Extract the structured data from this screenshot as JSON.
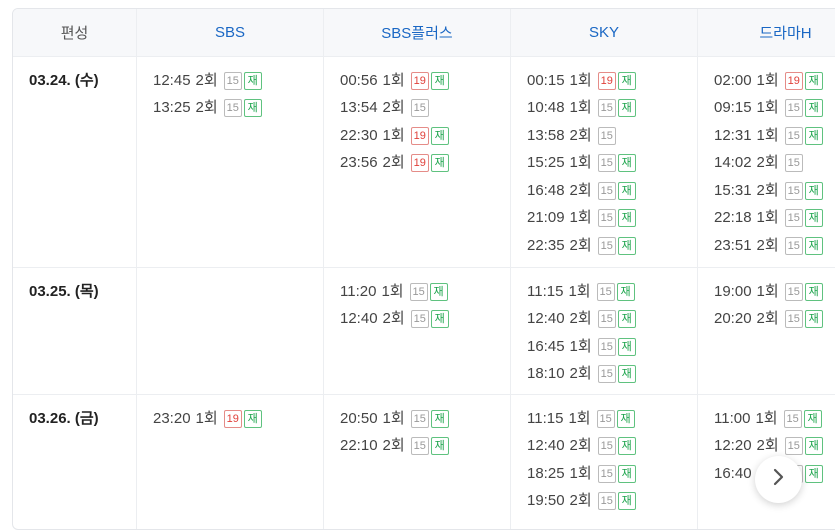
{
  "header": {
    "col0": "편성",
    "channels": [
      "SBS",
      "SBS플러스",
      "SKY",
      "드라마H"
    ]
  },
  "badges": {
    "age15": "15",
    "age19": "19",
    "rerun": "재"
  },
  "rows": [
    {
      "date": "03.24. (수)",
      "channels": [
        [
          {
            "time": "12:45",
            "ep": "2회",
            "age": "15",
            "rerun": true
          },
          {
            "time": "13:25",
            "ep": "2회",
            "age": "15",
            "rerun": true
          }
        ],
        [
          {
            "time": "00:56",
            "ep": "1회",
            "age": "19",
            "rerun": true
          },
          {
            "time": "13:54",
            "ep": "2회",
            "age": "15",
            "rerun": false
          },
          {
            "time": "22:30",
            "ep": "1회",
            "age": "19",
            "rerun": true
          },
          {
            "time": "23:56",
            "ep": "2회",
            "age": "19",
            "rerun": true
          }
        ],
        [
          {
            "time": "00:15",
            "ep": "1회",
            "age": "19",
            "rerun": true
          },
          {
            "time": "10:48",
            "ep": "1회",
            "age": "15",
            "rerun": true
          },
          {
            "time": "13:58",
            "ep": "2회",
            "age": "15",
            "rerun": false
          },
          {
            "time": "15:25",
            "ep": "1회",
            "age": "15",
            "rerun": true
          },
          {
            "time": "16:48",
            "ep": "2회",
            "age": "15",
            "rerun": true
          },
          {
            "time": "21:09",
            "ep": "1회",
            "age": "15",
            "rerun": true
          },
          {
            "time": "22:35",
            "ep": "2회",
            "age": "15",
            "rerun": true
          }
        ],
        [
          {
            "time": "02:00",
            "ep": "1회",
            "age": "19",
            "rerun": true
          },
          {
            "time": "09:15",
            "ep": "1회",
            "age": "15",
            "rerun": true
          },
          {
            "time": "12:31",
            "ep": "1회",
            "age": "15",
            "rerun": true
          },
          {
            "time": "14:02",
            "ep": "2회",
            "age": "15",
            "rerun": false
          },
          {
            "time": "15:31",
            "ep": "2회",
            "age": "15",
            "rerun": true
          },
          {
            "time": "22:18",
            "ep": "1회",
            "age": "15",
            "rerun": true
          },
          {
            "time": "23:51",
            "ep": "2회",
            "age": "15",
            "rerun": true
          }
        ]
      ]
    },
    {
      "date": "03.25. (목)",
      "channels": [
        [],
        [
          {
            "time": "11:20",
            "ep": "1회",
            "age": "15",
            "rerun": true
          },
          {
            "time": "12:40",
            "ep": "2회",
            "age": "15",
            "rerun": true
          }
        ],
        [
          {
            "time": "11:15",
            "ep": "1회",
            "age": "15",
            "rerun": true
          },
          {
            "time": "12:40",
            "ep": "2회",
            "age": "15",
            "rerun": true
          },
          {
            "time": "16:45",
            "ep": "1회",
            "age": "15",
            "rerun": true
          },
          {
            "time": "18:10",
            "ep": "2회",
            "age": "15",
            "rerun": true
          }
        ],
        [
          {
            "time": "19:00",
            "ep": "1회",
            "age": "15",
            "rerun": true
          },
          {
            "time": "20:20",
            "ep": "2회",
            "age": "15",
            "rerun": true
          }
        ]
      ]
    },
    {
      "date": "03.26. (금)",
      "channels": [
        [
          {
            "time": "23:20",
            "ep": "1회",
            "age": "19",
            "rerun": true
          }
        ],
        [
          {
            "time": "20:50",
            "ep": "1회",
            "age": "15",
            "rerun": true
          },
          {
            "time": "22:10",
            "ep": "2회",
            "age": "15",
            "rerun": true
          }
        ],
        [
          {
            "time": "11:15",
            "ep": "1회",
            "age": "15",
            "rerun": true
          },
          {
            "time": "12:40",
            "ep": "2회",
            "age": "15",
            "rerun": true
          },
          {
            "time": "18:25",
            "ep": "1회",
            "age": "15",
            "rerun": true
          },
          {
            "time": "19:50",
            "ep": "2회",
            "age": "15",
            "rerun": true
          }
        ],
        [
          {
            "time": "11:00",
            "ep": "1회",
            "age": "15",
            "rerun": true
          },
          {
            "time": "12:20",
            "ep": "2회",
            "age": "15",
            "rerun": true
          },
          {
            "time": "16:40",
            "ep": "1회",
            "age": "15",
            "rerun": true
          }
        ]
      ]
    }
  ],
  "next_button": {
    "icon": "chevron-right-icon"
  }
}
